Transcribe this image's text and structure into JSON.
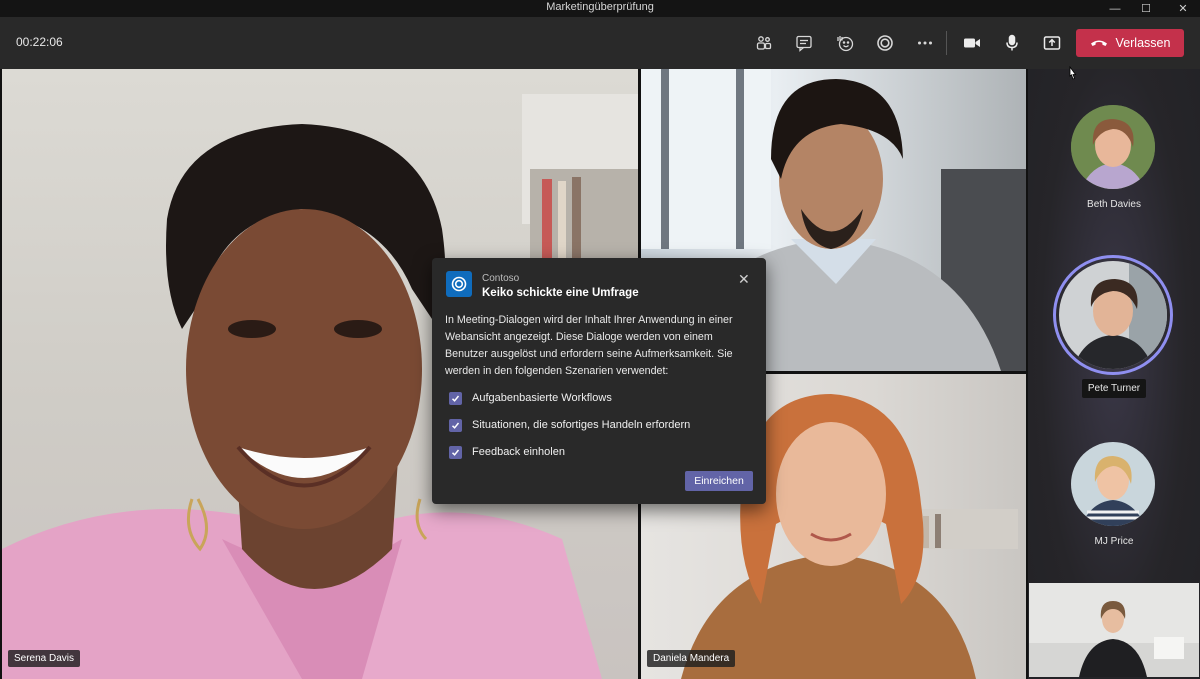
{
  "window": {
    "title": "Marketingüberprüfung"
  },
  "toolbar": {
    "timer": "00:22:06",
    "leave_label": "Verlassen"
  },
  "participants": {
    "main": [
      {
        "name": "Serena Davis"
      },
      {
        "name": "Daniela Mandera"
      }
    ],
    "rail": [
      {
        "name": "Beth Davies"
      },
      {
        "name": "Pete Turner"
      },
      {
        "name": "MJ Price"
      }
    ]
  },
  "dialog": {
    "app_name": "Contoso",
    "title": "Keiko schickte eine Umfrage",
    "body": "In Meeting-Dialogen wird der Inhalt Ihrer Anwendung in einer Webansicht angezeigt. Diese Dialoge werden von einem Benutzer ausgelöst und erfordern seine Aufmerksamkeit. Sie werden in den folgenden Szenarien verwendet:",
    "options": [
      {
        "label": "Aufgabenbasierte Workflows",
        "checked": true
      },
      {
        "label": "Situationen, die sofortiges Handeln erfordern",
        "checked": true
      },
      {
        "label": "Feedback einholen",
        "checked": true
      }
    ],
    "submit_label": "Einreichen"
  },
  "colors": {
    "accent": "#6264a7",
    "leave": "#c4314b",
    "toolbar": "#292929",
    "titlebar": "#141414"
  }
}
